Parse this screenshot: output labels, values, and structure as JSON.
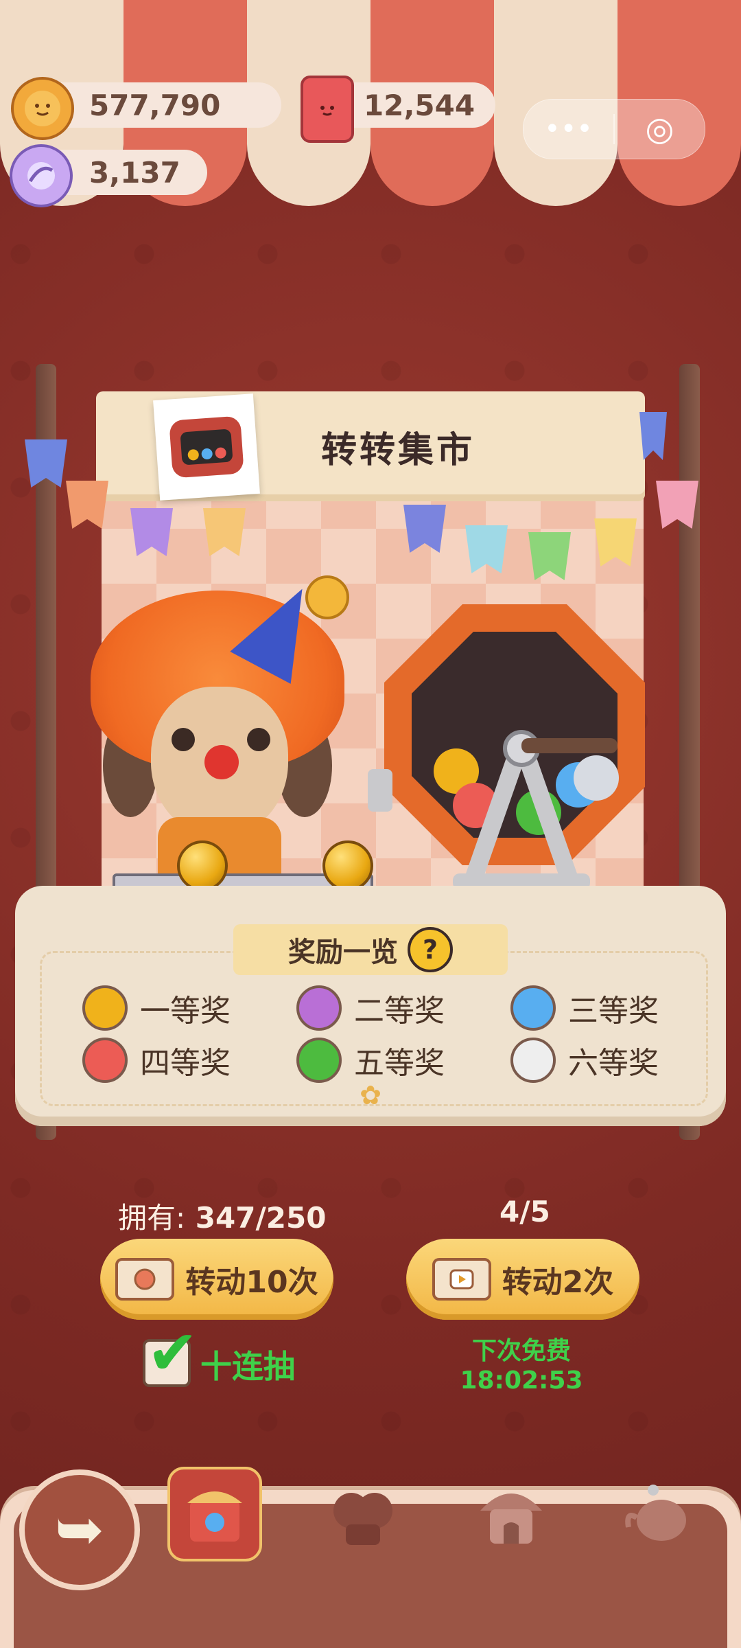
{
  "currencies": {
    "cookie": {
      "value": "577,790",
      "icon": "cookie-icon"
    },
    "candle": {
      "value": "12,544",
      "icon": "candle-icon"
    },
    "candy": {
      "value": "3,137",
      "icon": "candy-icon"
    }
  },
  "capsule": {
    "more": "•••",
    "close": "◎"
  },
  "stall": {
    "title": "转转集市"
  },
  "rewards": {
    "title": "奖励一览",
    "help": "?",
    "prizes": [
      {
        "label": "一等奖",
        "color": "#f0b21b"
      },
      {
        "label": "二等奖",
        "color": "#b96fd6"
      },
      {
        "label": "三等奖",
        "color": "#58aef0"
      },
      {
        "label": "四等奖",
        "color": "#ec5c55"
      },
      {
        "label": "五等奖",
        "color": "#4dbb3f"
      },
      {
        "label": "六等奖",
        "color": "#eeeeee"
      }
    ]
  },
  "owned": {
    "label": "拥有:",
    "value": "347/250"
  },
  "video_quota": "4/5",
  "buttons": {
    "spin10": "转动10次",
    "spin2": "转动2次"
  },
  "ten_draw": {
    "label": "十连抽",
    "checked": true
  },
  "free": {
    "label": "下次免费",
    "timer": "18:02:53"
  },
  "nav": {
    "back": "back-icon",
    "items": [
      "market-stall-icon",
      "costume-icon",
      "house-icon",
      "teapot-icon"
    ]
  }
}
